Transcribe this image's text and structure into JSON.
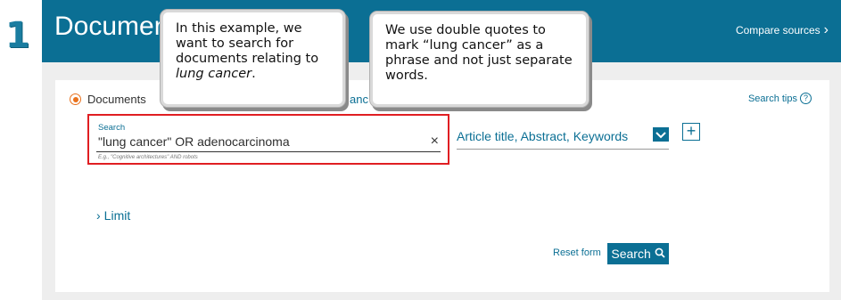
{
  "step_number": "1",
  "header": {
    "title": "Documen",
    "compare_link": "Compare sources"
  },
  "form": {
    "radio_documents_label": "Documents",
    "hidden_tab_fragment": "anc",
    "search_tips": "Search tips",
    "search_label": "Search",
    "search_value": "\"lung cancer\" OR adenocarcinoma",
    "search_example": "E.g., \"Cognitive architectures\" AND robots",
    "field_select_value": "Article title, Abstract, Keywords",
    "limit_label": "Limit",
    "reset_label": "Reset form",
    "search_button_label": "Search"
  },
  "callouts": {
    "first": {
      "text": "In this example, we want to search for documents relating to",
      "italic": "lung cancer",
      "tail": "."
    },
    "second": {
      "text": "We use double quotes to mark “lung cancer” as a phrase and not just separate words."
    }
  },
  "colors": {
    "brand_blue": "#0b6f94",
    "highlight_red": "#e01e22",
    "radio_orange": "#e9711c"
  }
}
